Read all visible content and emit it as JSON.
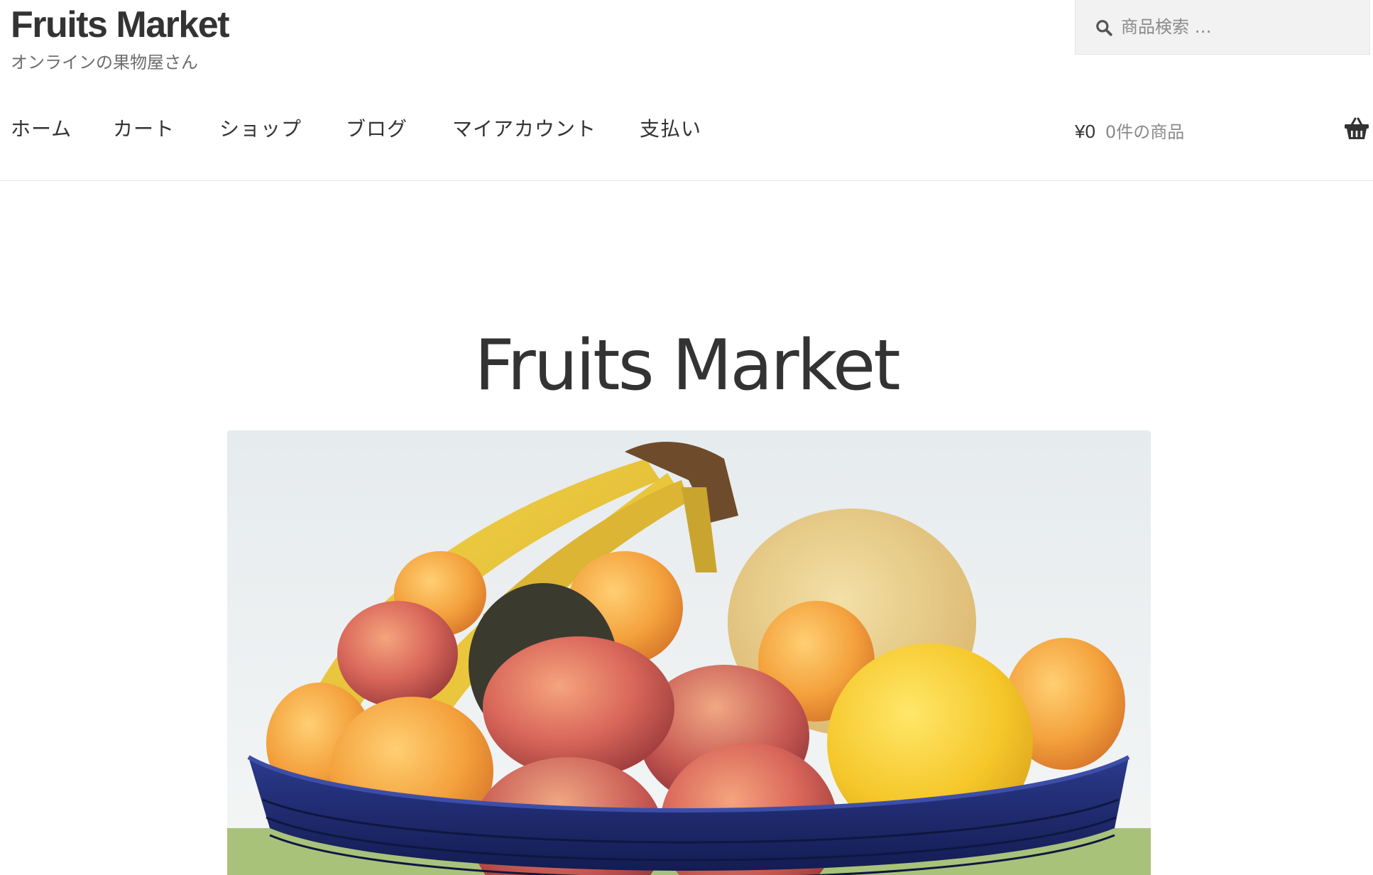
{
  "site": {
    "title": "Fruits Market",
    "tagline": "オンラインの果物屋さん"
  },
  "search": {
    "placeholder": "商品検索 …",
    "icon": "search-icon"
  },
  "nav": {
    "items": [
      {
        "label": "ホーム"
      },
      {
        "label": "カート"
      },
      {
        "label": "ショップ"
      },
      {
        "label": "ブログ"
      },
      {
        "label": "マイアカウント"
      },
      {
        "label": "支払い"
      }
    ]
  },
  "cart": {
    "amount": "¥0",
    "count": "0件の商品",
    "icon": "basket-icon"
  },
  "page": {
    "heading": "Fruits Market"
  },
  "hero": {
    "icon": "fruit-bowl-photo"
  },
  "colors": {
    "text": "#333333",
    "muted": "#6d6d6d",
    "search_bg": "#f2f2f2",
    "bowl": "#1f2a6b"
  }
}
